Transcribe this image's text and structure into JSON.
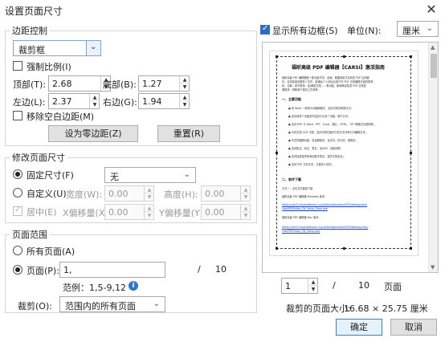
{
  "dialog": {
    "title": "设置页面尺寸",
    "close_glyph": "✕"
  },
  "margins": {
    "group_label": "边距控制",
    "box_type": "裁剪框",
    "keep_ratio_label": "强制比例(I)",
    "top_label": "顶部(T):",
    "top_value": "2.68",
    "bottom_label": "底部(B):",
    "bottom_value": "1.27",
    "left_label": "左边(L):",
    "left_value": "2.37",
    "right_label": "右边(G):",
    "right_value": "1.94",
    "remove_white_label": "移除空白边距(M)",
    "set_zero_button": "设为零边距(Z)",
    "reset_button": "重置(R)"
  },
  "page_size": {
    "group_label": "修改页面尺寸",
    "fixed_label": "固定尺寸(F)",
    "fixed_value": "无",
    "custom_label": "自定义(U)",
    "width_label": "宽度(W):",
    "width_value": "0.00",
    "height_label": "高度(H):",
    "height_value": "0.00",
    "center_label": "居中(E)",
    "x_offset_label": "X偏移量(X):",
    "x_offset_value": "0.00",
    "y_offset_label": "Y偏移量(Y):",
    "y_offset_value": "0.00"
  },
  "page_range": {
    "group_label": "页面范围",
    "all_pages_label": "所有页面(A)",
    "pages_label": "页面(P):",
    "pages_value": "1,",
    "slash": "/",
    "total_pages": "10",
    "example_text": "范例：1,5-9,12",
    "info_glyph": "i",
    "crop_label": "裁剪(O):",
    "crop_value": "范围内的所有页面"
  },
  "preview": {
    "show_boxes_label": "显示所有边框(S)",
    "unit_label": "单位(N):",
    "unit_value": "厘米",
    "page_number": "1",
    "slash": "/",
    "total": "10",
    "page_suffix": "页面",
    "cropped_size_label": "裁剪的页面大小:",
    "cropped_size_value": "16.68 × 25.75 厘米",
    "doc": {
      "title": "福昕高级 PDF 编辑器【CARSI】激活指南",
      "intro1": "福昕高级 PDF 编辑器是一款功能丰富、全面、便捷易用又高效的 PDF 应用套",
      "intro2": "件，支持批量处理多个文件，能满足个人和企业用户在 PDF 文档编辑方面的需求。",
      "intro3": "标、注释、填写表单、加/解密文档……等功能，能够满足各类 PDF 文档处",
      "intro4": "理需求，帮助用户提高工作效率。",
      "section1": "一、主要功能",
      "b1": "● 将 Word 一秒转为可编辑格式，支持识别并转换文字；",
      "b2": "● 支持将单个页面的内容拆分为多个页面，便于分享；",
      "b3": "● 支持 PDF 与 Word、PPT、Excel、图片、HTML、TXT 等格式互相转换；",
      "b4": "● 可将文档 OCR 识别，支持识别扫描件中的文字并转为可编辑文本；",
      "b5": "● 丰富的编辑功能，包含删除页、合并页、拆分页、提取页；",
      "b6": "● 支持批注、标注、签名、加水印、页眉页脚；",
      "b7": "● 支持加密保护和添加数字签名，保护文档安全；",
      "b8": "● 支持 PDF 文件共享，方便多人协作。",
      "section2": "二、软件下载",
      "dl1": "方式一：点击文件链接下载",
      "dl2": "福昕高级 PDF 编辑器 Windows 版本：",
      "link1": "https://cdn01.foxitsoftware.cn/pub/foxit/phantomPDF/desktop/win/",
      "link2": "FoxitPDFEditor_CN_Setup_Prom.exe",
      "dl3": "福昕高级 PDF 编辑器 Mac 版本：",
      "link3": "https://cdn01.foxitsoftware.cn/pub/foxit/phantomPDF/desktop/mac/",
      "link4": "FoxitPDFEditor_CN_Setup.pkg"
    }
  },
  "footer": {
    "ok_button": "确定",
    "cancel_button": "取消"
  },
  "glyphs": {
    "chevron_down": "⌄",
    "spin_up": "▲",
    "spin_down": "▼",
    "scroll_up": "▲",
    "scroll_down": "▼"
  }
}
